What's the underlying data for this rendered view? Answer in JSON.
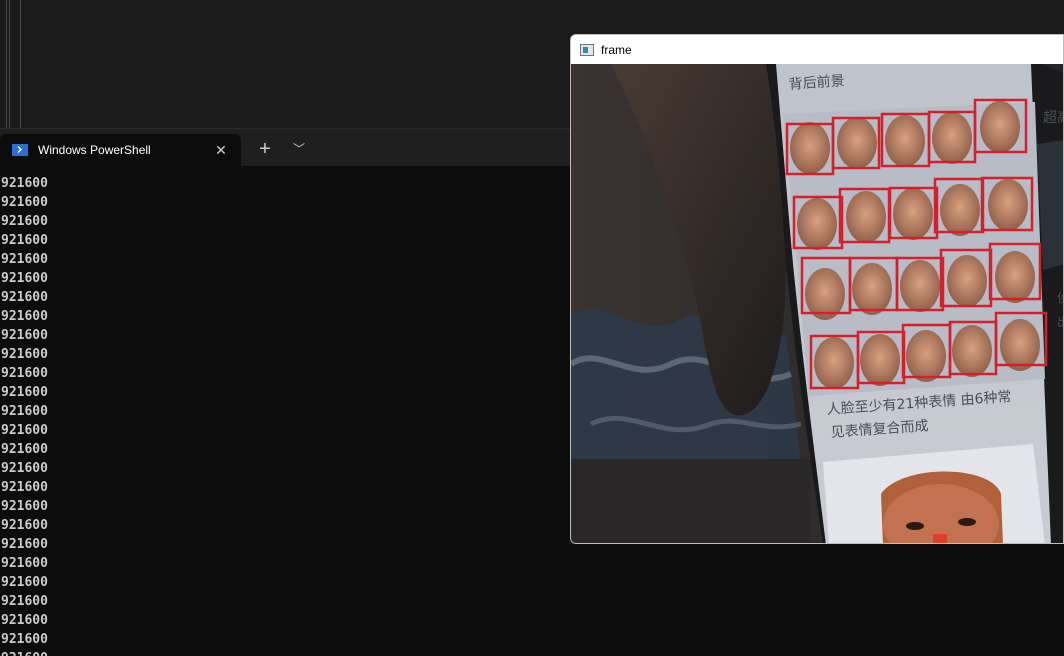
{
  "terminal": {
    "tab_title": "Windows PowerShell",
    "output_lines": [
      "921600",
      "921600",
      "921600",
      "921600",
      "921600",
      "921600",
      "921600",
      "921600",
      "921600",
      "921600",
      "921600",
      "921600",
      "921600",
      "921600",
      "921600",
      "921600",
      "921600",
      "921600",
      "921600",
      "921600",
      "921600",
      "921600",
      "921600",
      "921600",
      "921600",
      "921600"
    ]
  },
  "frame_window": {
    "title": "frame",
    "scene_text": {
      "top_left": "背后前景",
      "top_right": "超高",
      "caption_line1": "人脸至少有21种表情 由6种常",
      "caption_line2": "见表情复合而成",
      "side_char1": "侦",
      "side_char2": "出"
    }
  },
  "colors": {
    "detection_box": "#d4202a",
    "terminal_bg": "#0c0c0c",
    "tab_bg": "#1f1f1f",
    "text": "#cccccc"
  },
  "icons": {
    "tab": "powershell-icon",
    "close": "close-icon",
    "add": "plus-icon",
    "dropdown": "chevron-down-icon",
    "window": "opencv-window-icon"
  }
}
